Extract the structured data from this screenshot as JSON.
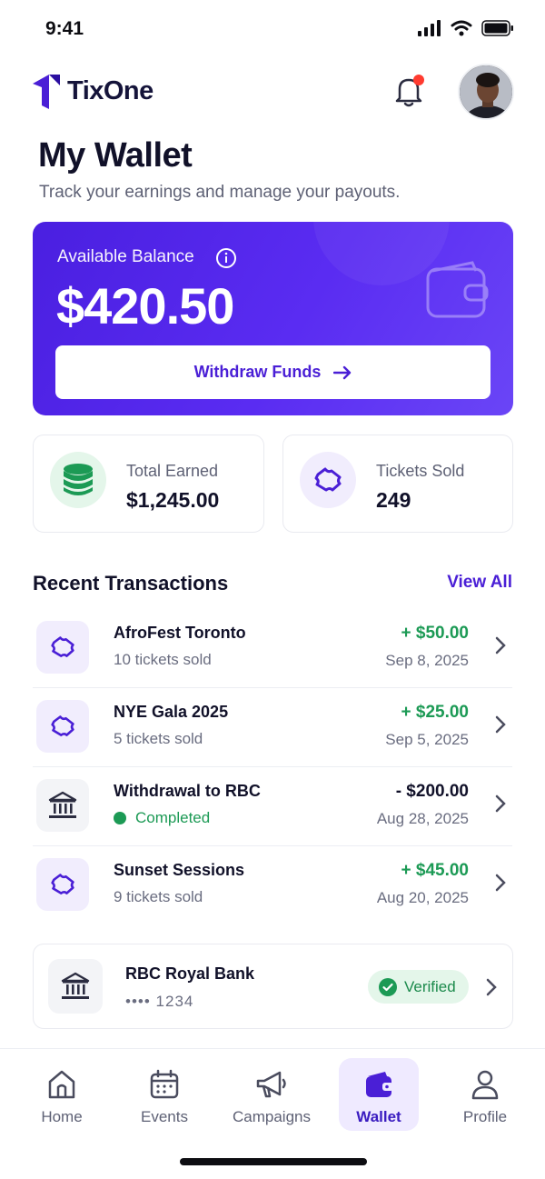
{
  "status_bar": {
    "time": "9:41"
  },
  "header": {
    "brand": "TixOne"
  },
  "page": {
    "title": "My Wallet",
    "subtitle": "Track your earnings and manage your payouts."
  },
  "balance": {
    "label": "Available Balance",
    "amount": "$420.50",
    "withdraw_label": "Withdraw Funds"
  },
  "stats": [
    {
      "label": "Total Earned",
      "value": "$1,245.00",
      "icon": "coins-stack-icon"
    },
    {
      "label": "Tickets Sold",
      "value": "249",
      "icon": "ticket-icon"
    }
  ],
  "transactions_section": {
    "title": "Recent Transactions",
    "view_all": "View All"
  },
  "transactions": [
    {
      "title": "AfroFest Toronto",
      "subtitle": "10 tickets sold",
      "amount": "+ $50.00",
      "date": "Sep 8, 2025",
      "icon": "ticket-icon"
    },
    {
      "title": "NYE Gala 2025",
      "subtitle": "5 tickets sold",
      "amount": "+ $25.00",
      "date": "Sep 5, 2025",
      "icon": "ticket-icon"
    },
    {
      "title": "Withdrawal to RBC",
      "subtitle": "Completed",
      "amount": "- $200.00",
      "date": "Aug 28, 2025",
      "icon": "bank-icon"
    },
    {
      "title": "Sunset Sessions",
      "subtitle": "9 tickets sold",
      "amount": "+ $45.00",
      "date": "Aug 20, 2025",
      "icon": "ticket-icon"
    }
  ],
  "bank": {
    "name": "RBC Royal Bank",
    "account": "•••• 1234",
    "status": "Verified"
  },
  "nav": [
    {
      "label": "Home",
      "icon": "home-icon"
    },
    {
      "label": "Events",
      "icon": "calendar-icon"
    },
    {
      "label": "Campaigns",
      "icon": "megaphone-icon"
    },
    {
      "label": "Wallet",
      "icon": "wallet-icon",
      "active": true
    },
    {
      "label": "Profile",
      "icon": "user-icon"
    }
  ],
  "colors": {
    "brand": "#4a1fd6",
    "positive": "#1c9a55",
    "card_gradient_start": "#4a1fe0",
    "card_gradient_end": "#6a45f6"
  }
}
